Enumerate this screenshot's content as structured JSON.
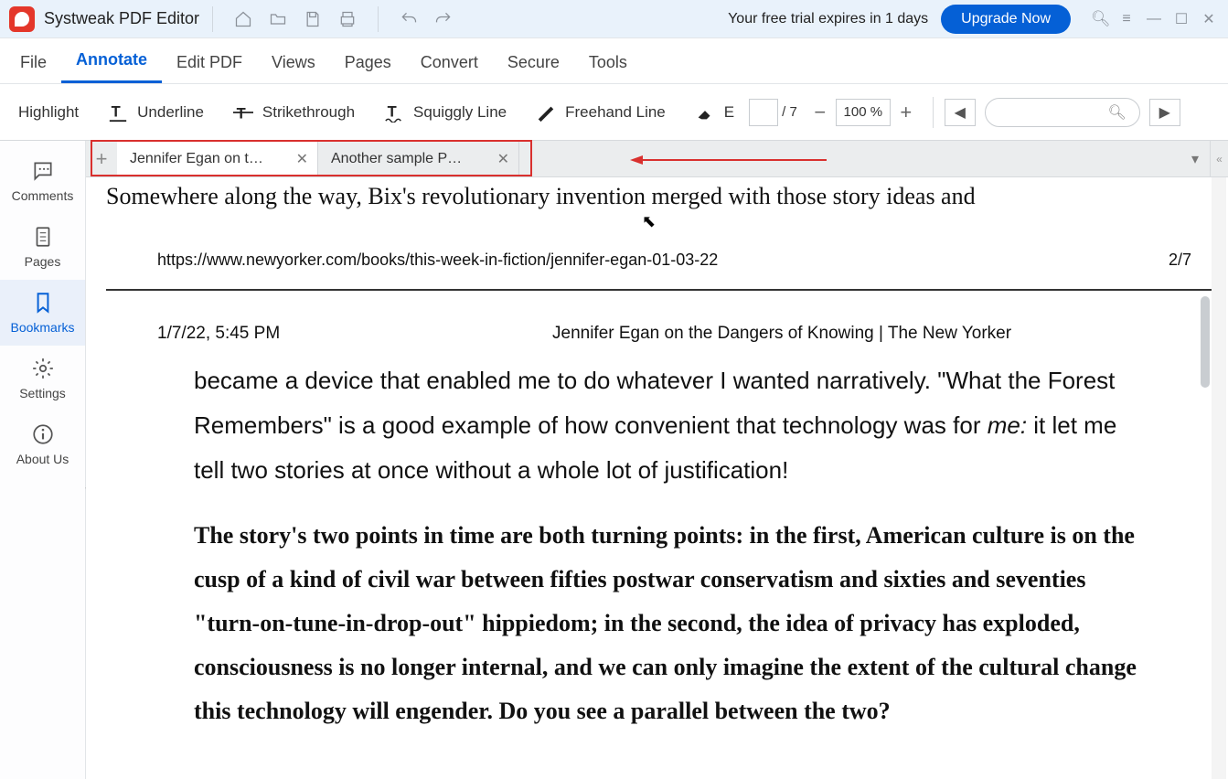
{
  "app": {
    "title": "Systweak PDF Editor"
  },
  "trial": {
    "text": "Your free trial expires in 1 days",
    "upgrade": "Upgrade Now"
  },
  "menu": {
    "items": [
      "File",
      "Annotate",
      "Edit PDF",
      "Views",
      "Pages",
      "Convert",
      "Secure",
      "Tools"
    ],
    "active_index": 1
  },
  "toolbar": {
    "highlight": "Highlight",
    "underline": "Underline",
    "strike": "Strikethrough",
    "squiggly": "Squiggly Line",
    "freehand": "Freehand Line",
    "eraser_short": "E",
    "page_current": "",
    "page_total": "/ 7",
    "zoom": "100 %"
  },
  "sidebar": {
    "items": [
      {
        "label": "Comments"
      },
      {
        "label": "Pages"
      },
      {
        "label": "Bookmarks"
      },
      {
        "label": "Settings"
      },
      {
        "label": "About Us"
      }
    ],
    "active_index": 2
  },
  "tabs": {
    "items": [
      {
        "label": "Jennifer Egan on t…",
        "active": true
      },
      {
        "label": "Another sample P…",
        "active": false
      }
    ]
  },
  "doc": {
    "top_line": "Somewhere along the way, Bix's revolutionary invention merged with those story ideas and",
    "url": "https://www.newyorker.com/books/this-week-in-fiction/jennifer-egan-01-03-22",
    "page_indicator": "2/7",
    "date": "1/7/22, 5:45 PM",
    "header_title": "Jennifer Egan on the Dangers of Knowing | The New Yorker",
    "p1_a": "became a device that enabled me to do whatever I wanted narratively. \"What the Forest Remembers\" is a good example of how convenient that technology was for ",
    "p1_it": "me:",
    "p1_b": " it let me tell two stories at once without a whole lot of justification!",
    "p2": "The story's two points in time are both turning points: in the first, American culture is on the cusp of a kind of civil war between fifties postwar conservatism and sixties and seventies \"turn-on-tune-in-drop-out\" hippiedom; in the second, the idea of privacy has exploded, consciousness is no longer internal, and we can only imagine the extent of the cultural change this technology will engender. Do you see a parallel between the two?"
  }
}
